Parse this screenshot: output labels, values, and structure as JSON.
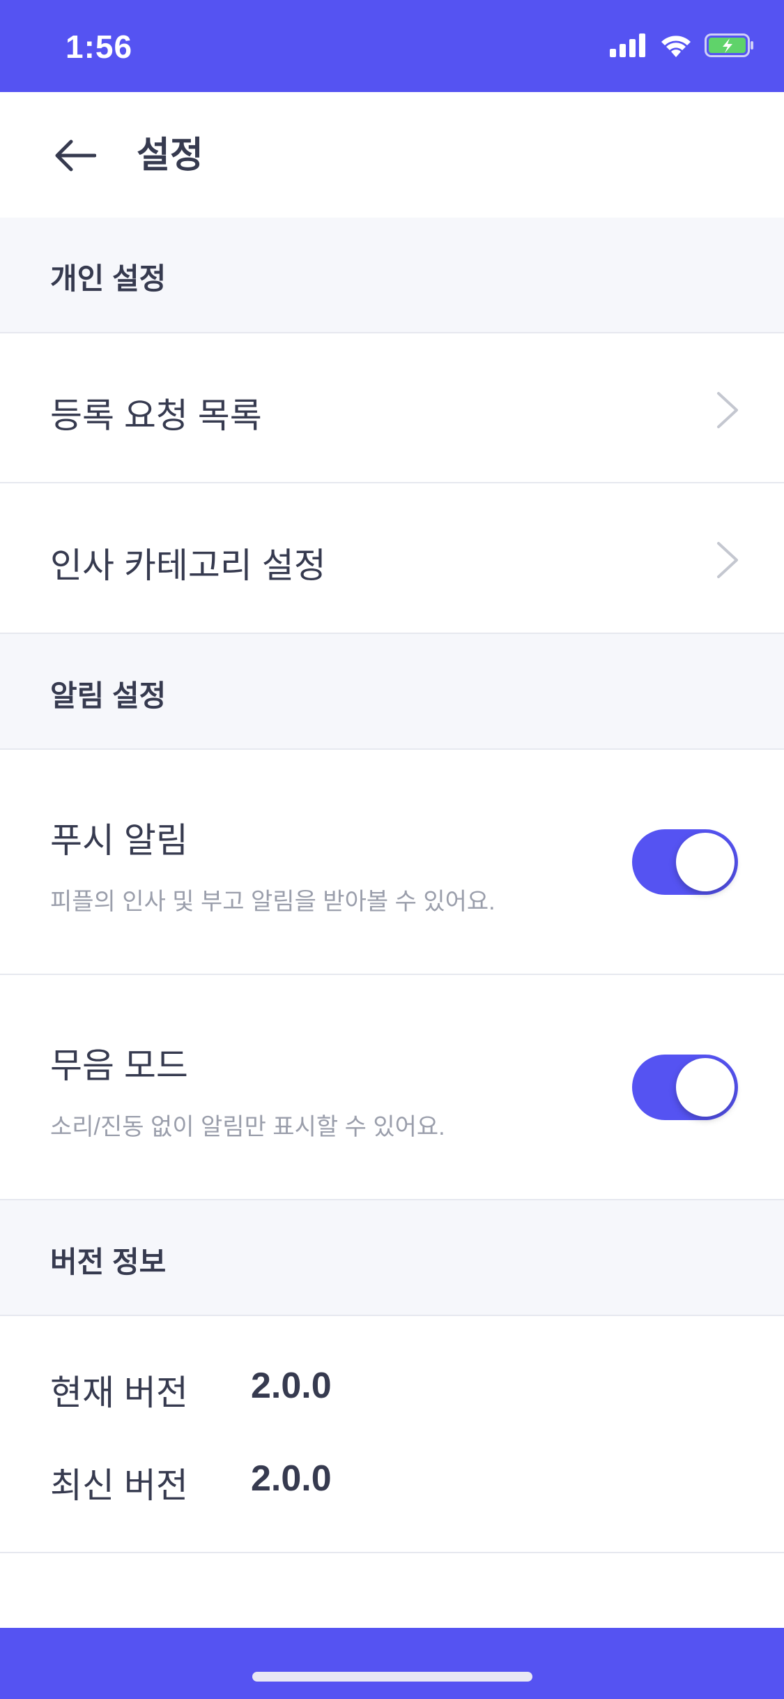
{
  "status_bar": {
    "time": "1:56",
    "background": "#5553f2",
    "icons": [
      "cellular-signal-icon",
      "wifi-icon",
      "battery-charging-icon"
    ]
  },
  "nav": {
    "back_icon": "arrow-left-icon",
    "title": "설정"
  },
  "sections": {
    "personal": {
      "header": "개인 설정",
      "items": [
        {
          "label": "등록 요청 목록",
          "icon": "chevron-right-icon"
        },
        {
          "label": "인사 카테고리 설정",
          "icon": "chevron-right-icon"
        }
      ]
    },
    "notifications": {
      "header": "알림 설정",
      "items": [
        {
          "label": "푸시 알림",
          "description": "피플의 인사 및 부고 알림을 받아볼 수 있어요.",
          "enabled": true
        },
        {
          "label": "무음 모드",
          "description": "소리/진동 없이 알림만 표시할 수 있어요.",
          "enabled": true
        }
      ]
    },
    "version": {
      "header": "버전 정보",
      "current_label": "현재 버전",
      "current_value": "2.0.0",
      "latest_label": "최신 버전",
      "latest_value": "2.0.0"
    }
  },
  "colors": {
    "accent": "#5553f2",
    "section_bg": "#f6f7fb",
    "text_primary": "#363a4f",
    "text_secondary": "#9a9eab",
    "divider": "#e6e8ef"
  }
}
